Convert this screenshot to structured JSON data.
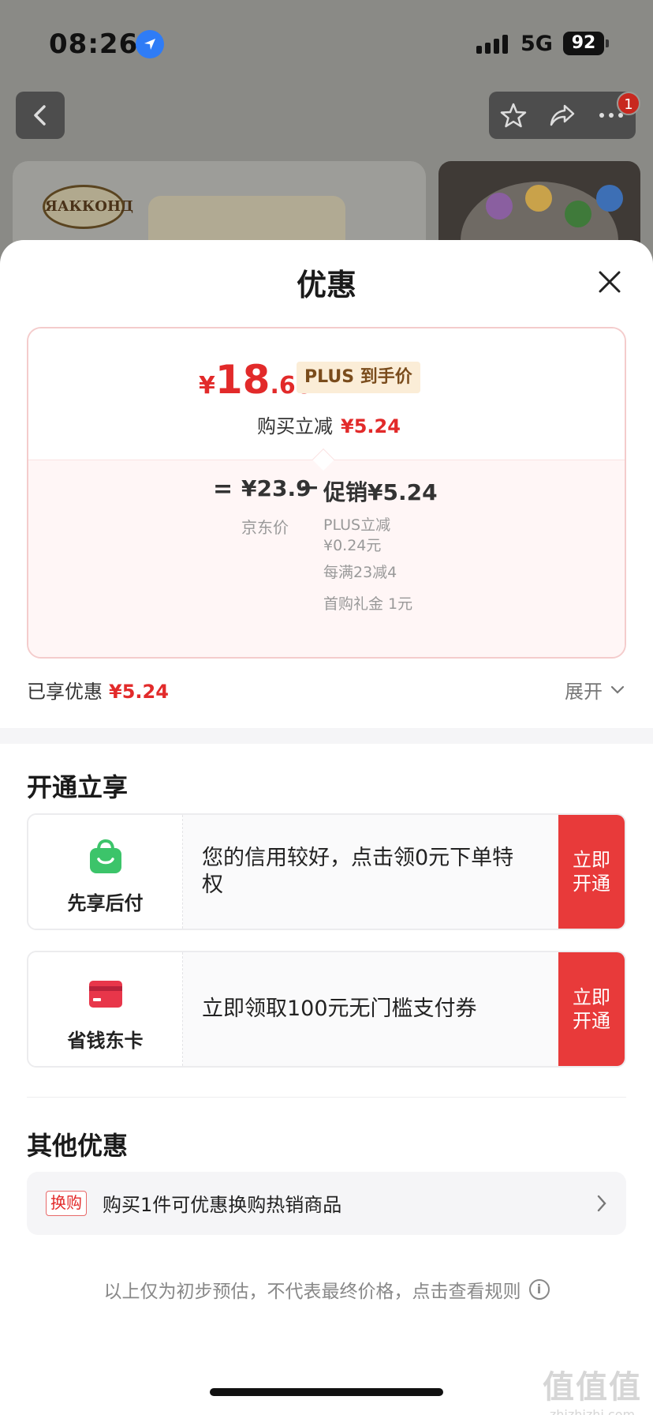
{
  "status_bar": {
    "time": "08:26",
    "network": "5G",
    "battery": "92"
  },
  "nav": {
    "notification_count": "1"
  },
  "background_product": {
    "brand_logo_text": "ЯАККОНД"
  },
  "sheet": {
    "title": "优惠",
    "price_breakdown": {
      "final_price_symbol": "¥",
      "final_price_integer": "18",
      "final_price_decimal": ".66",
      "plus_tag": "PLUS 到手价",
      "buy_cut_label": "购买立减",
      "buy_cut_value": "¥5.24",
      "equals": "=",
      "jd_price": "¥23.9",
      "jd_price_label": "京东价",
      "minus": "−",
      "promo_label": "促销",
      "promo_value": "¥5.24",
      "promo_items": [
        "PLUS立减 ¥0.24元",
        "每满23减4",
        "首购礼金 1元"
      ]
    },
    "enjoyed": {
      "label": "已享优惠",
      "value": "¥5.24",
      "expand_label": "展开"
    },
    "activate_section": {
      "title": "开通立享",
      "offers": [
        {
          "name": "先享后付",
          "text": "您的信用较好，点击领0元下单特权",
          "button": "立即开通",
          "icon": "shopping-bag-icon"
        },
        {
          "name": "省钱东卡",
          "text": "立即领取100元无门槛支付券",
          "button": "立即开通",
          "icon": "card-icon"
        }
      ]
    },
    "other_section": {
      "title": "其他优惠",
      "swap_tag": "换购",
      "swap_text": "购买1件可优惠换购热销商品"
    },
    "disclaimer": "以上仅为初步预估，不代表最终价格，点击查看规则"
  },
  "watermark": {
    "line1": "值值值",
    "line2": "zhizhizhi.com"
  },
  "colors": {
    "accent_red": "#e22a2a",
    "button_red": "#e83a3a",
    "plus_gold": "#7a4c1c",
    "green": "#3cc46a"
  }
}
